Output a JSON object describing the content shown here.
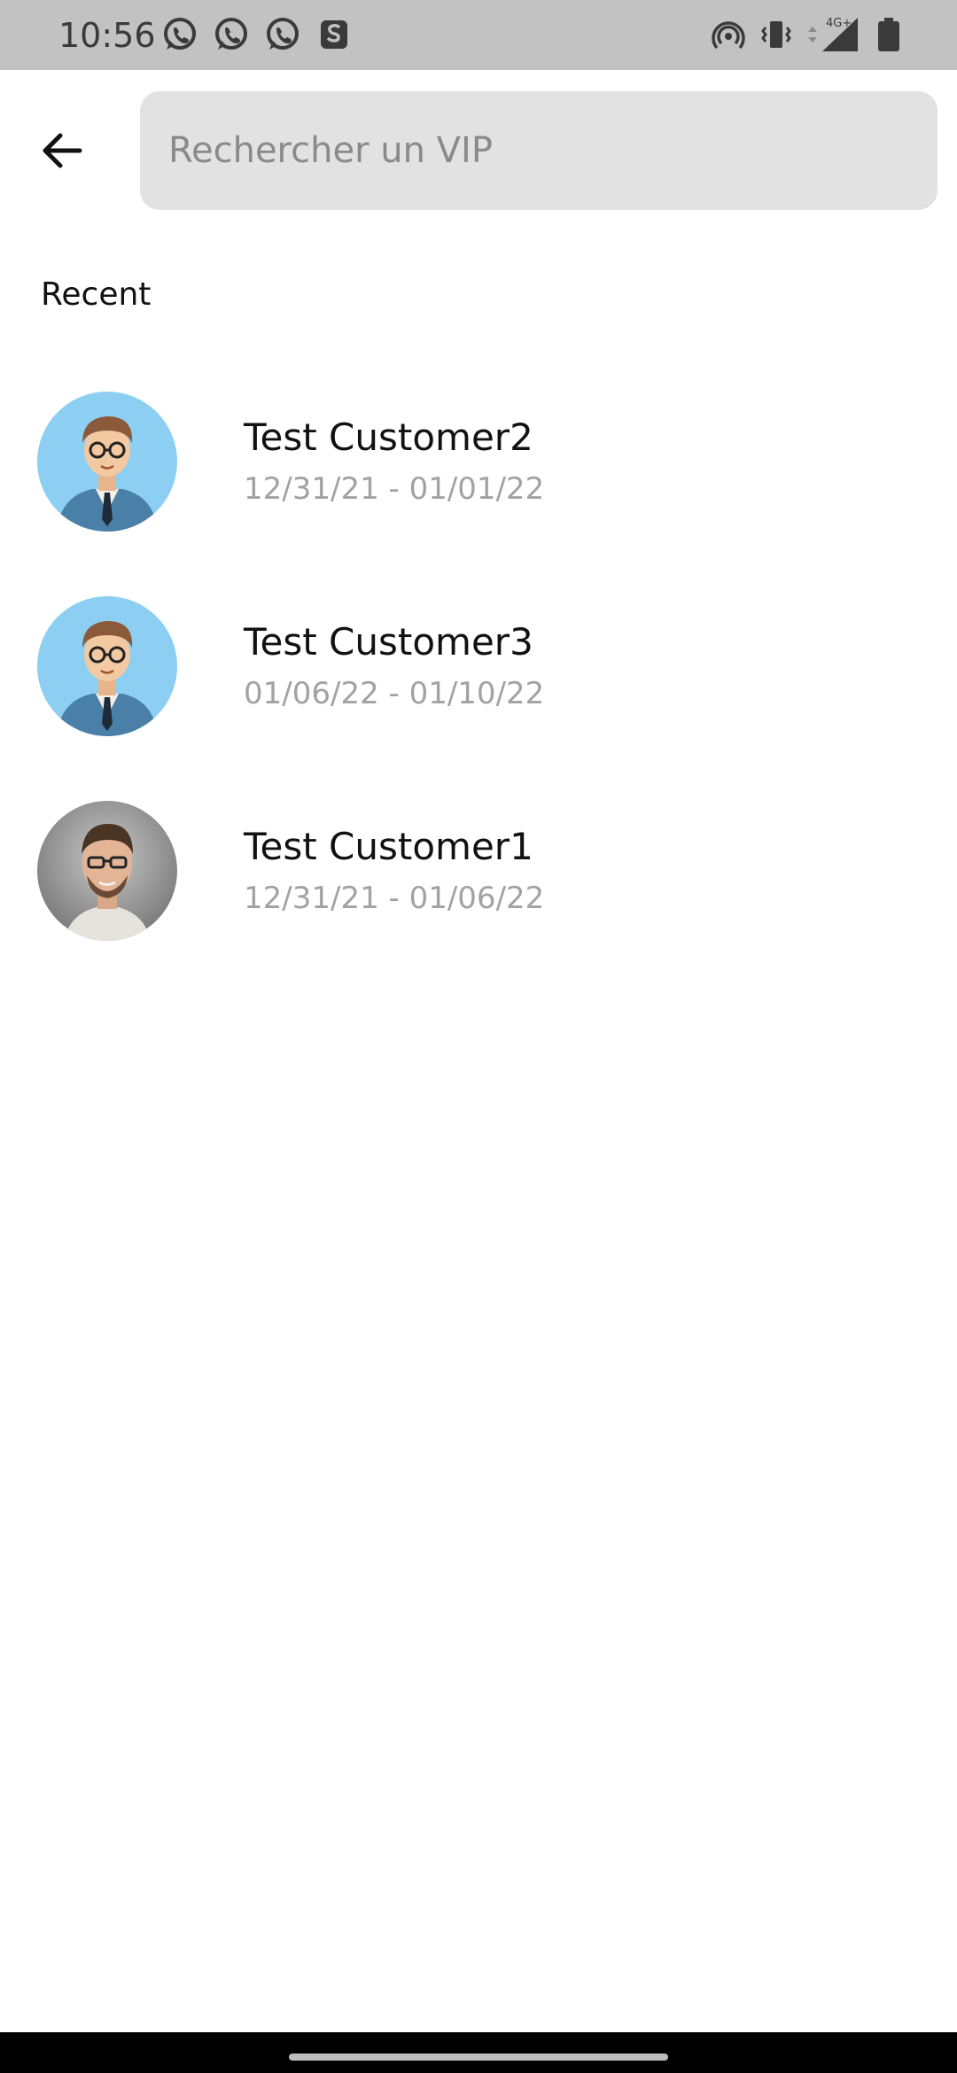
{
  "status_bar": {
    "time": "10:56",
    "left_icons": [
      "whatsapp-icon",
      "whatsapp-icon",
      "whatsapp-icon",
      "s-app-icon"
    ],
    "right_icons": [
      "hotspot-icon",
      "vibrate-icon",
      "signal-4g-icon",
      "battery-icon"
    ],
    "network_label": "4G+"
  },
  "header": {
    "back_icon": "arrow-left-icon",
    "search_placeholder": "Rechercher un VIP",
    "search_value": ""
  },
  "recent": {
    "title": "Recent",
    "items": [
      {
        "name": "Test Customer2",
        "dates": "12/31/21 - 01/01/22",
        "avatar": "cartoon-avatar"
      },
      {
        "name": "Test Customer3",
        "dates": "01/06/22 - 01/10/22",
        "avatar": "cartoon-avatar"
      },
      {
        "name": "Test Customer1",
        "dates": "12/31/21 - 01/06/22",
        "avatar": "photo-avatar"
      }
    ]
  },
  "colors": {
    "status_bar_bg": "#c2c2c2",
    "search_bg": "#e2e2e2",
    "avatar_bg": "#8ccff2",
    "secondary_text": "#a2a2a2"
  }
}
